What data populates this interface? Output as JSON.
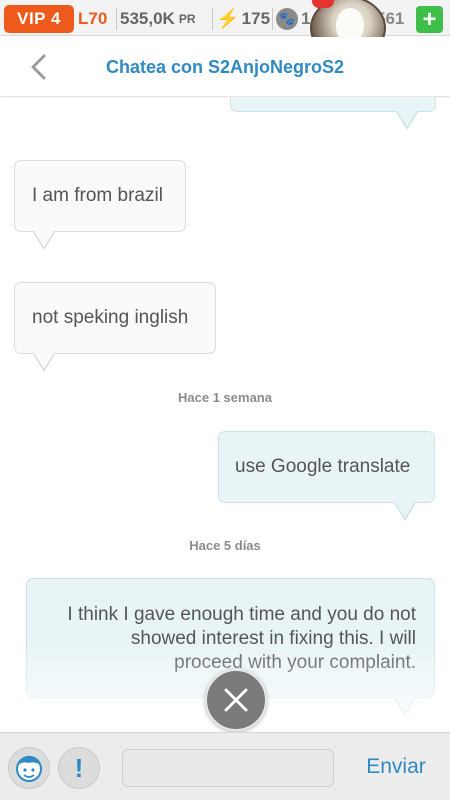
{
  "status_bar": {
    "vip": "VIP 4",
    "level": "L70",
    "pr_value": "535,0K",
    "pr_unit": "PR",
    "energy": "175",
    "paws": "1",
    "coins": "561",
    "plus_label": "+"
  },
  "header": {
    "title": "Chatea con S2AnjoNegroS2"
  },
  "messages": [
    {
      "text": "I am from brazil",
      "direction": "incoming"
    },
    {
      "text": "not speking inglish",
      "direction": "incoming"
    },
    {
      "timestamp": "Hace 1 semana"
    },
    {
      "text": "use Google translate",
      "direction": "outgoing"
    },
    {
      "timestamp": "Hace 5 días"
    },
    {
      "lines": [
        "I think I gave enough time and you do not",
        "showed interest in fixing this. I will",
        "proceed with your complaint."
      ],
      "direction": "outgoing"
    }
  ],
  "input_bar": {
    "input_value": "",
    "send_label": "Enviar",
    "alert_label": "!"
  },
  "colors": {
    "accent": "#2f8ac4",
    "vip": "#ee5a1c",
    "plus": "#3fbf4a",
    "outgoing_bubble": "#e8f4f6",
    "incoming_bubble": "#fafafa"
  },
  "icons": {
    "back": "chevron-left-icon",
    "energy": "lightning-icon",
    "paw": "paw-icon",
    "close": "close-icon",
    "face": "face-icon"
  }
}
